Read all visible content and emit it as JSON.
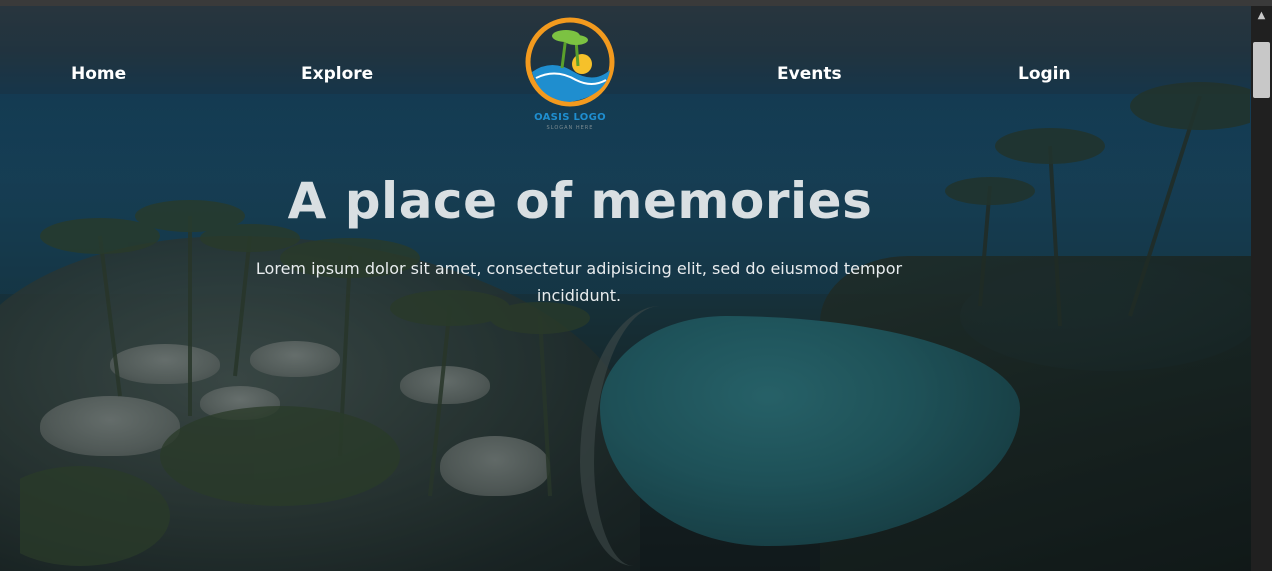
{
  "nav": {
    "items": [
      {
        "label": "Home"
      },
      {
        "label": "Explore"
      },
      {
        "label": "Events"
      },
      {
        "label": "Login"
      }
    ]
  },
  "logo": {
    "text": "OASIS LOGO",
    "slogan": "SLOGAN HERE"
  },
  "hero": {
    "title": "A place of memories",
    "subtitle": "Lorem ipsum dolor sit amet, consectetur adipisicing elit, sed do eiusmod tempor incididunt."
  },
  "colors": {
    "nav_text": "#ffffff",
    "title_text": "#d9dfe2",
    "logo_blue": "#1f8ecf",
    "logo_orange": "#f39a1e",
    "logo_green": "#7cc242"
  },
  "icons": {
    "scroll_up": "chevron-up-icon"
  }
}
